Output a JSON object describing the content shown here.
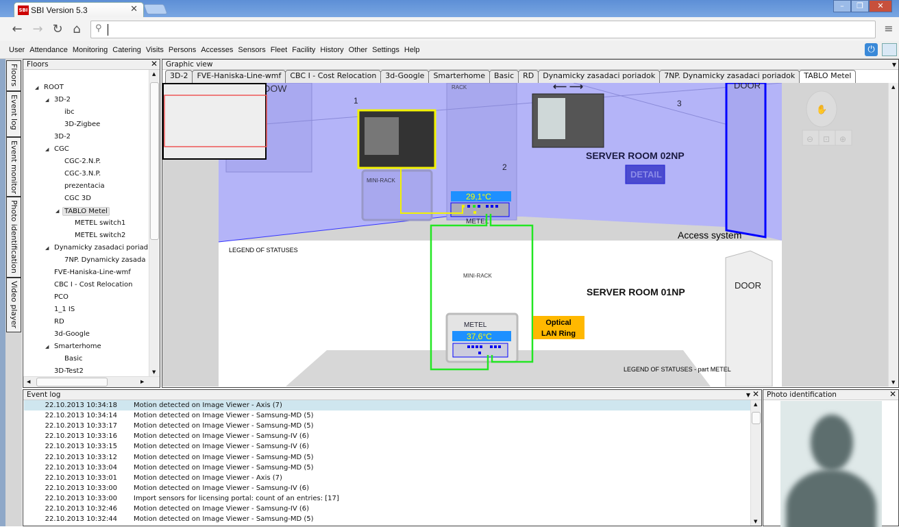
{
  "browser": {
    "tab_title": "SBI Version 5.3",
    "logo": "SBI",
    "address": "",
    "icons": [
      "back-icon",
      "forward-icon",
      "reload-icon",
      "home-icon",
      "search-icon",
      "menu-icon"
    ]
  },
  "menu": [
    "User",
    "Attendance",
    "Monitoring",
    "Catering",
    "Visits",
    "Persons",
    "Accesses",
    "Sensors",
    "Fleet",
    "Facility",
    "History",
    "Other",
    "Settings",
    "Help"
  ],
  "side_tabs": [
    "Floors",
    "Event log",
    "Event monitor",
    "Photo identification",
    "Video player"
  ],
  "floors": {
    "title": "Floors",
    "tree": [
      {
        "label": "ROOT",
        "level": 0,
        "expanded": true
      },
      {
        "label": "3D-2",
        "level": 1,
        "expanded": true
      },
      {
        "label": "ibc",
        "level": 2
      },
      {
        "label": "3D-Zigbee",
        "level": 2
      },
      {
        "label": "3D-2",
        "level": 1
      },
      {
        "label": "CGC",
        "level": 1,
        "expanded": true
      },
      {
        "label": "CGC-2.N.P.",
        "level": 2
      },
      {
        "label": "CGC-3.N.P.",
        "level": 2
      },
      {
        "label": "prezentacia",
        "level": 2
      },
      {
        "label": "CGC 3D",
        "level": 2
      },
      {
        "label": "TABLO Metel",
        "level": 2,
        "expanded": true,
        "selected": true
      },
      {
        "label": "METEL switch1",
        "level": 3
      },
      {
        "label": "METEL switch2",
        "level": 3
      },
      {
        "label": "Dynamicky zasadaci poriad",
        "level": 1,
        "expanded": true
      },
      {
        "label": "7NP. Dynamicky zasada",
        "level": 2
      },
      {
        "label": "FVE-Haniska-Line-wmf",
        "level": 1
      },
      {
        "label": "CBC I - Cost Relocation",
        "level": 1
      },
      {
        "label": "PCO",
        "level": 1
      },
      {
        "label": "1_1 IS",
        "level": 1
      },
      {
        "label": "RD",
        "level": 1
      },
      {
        "label": "3d-Google",
        "level": 1
      },
      {
        "label": "Smarterhome",
        "level": 1,
        "expanded": true
      },
      {
        "label": "Basic",
        "level": 2
      },
      {
        "label": "3D-Test2",
        "level": 1
      }
    ]
  },
  "graphic_view": {
    "title": "Graphic view",
    "tabs": [
      "3D-2",
      "FVE-Haniska-Line-wmf",
      "CBC I - Cost Relocation",
      "3d-Google",
      "Smarterhome",
      "Basic",
      "RD",
      "Dynamicky zasadaci poriadok",
      "7NP. Dynamicky zasadaci poriadok",
      "TABLO Metel"
    ],
    "active_tab": "TABLO Metel",
    "scene": {
      "window": "WINDOW",
      "rack": "RACK",
      "mini_rack_top": "MINI-RACK",
      "mini_rack_bottom": "MINI-RACK",
      "cam1": "1",
      "cam2": "2",
      "cam3": "3",
      "server_room_2": "SERVER ROOM 02NP",
      "detail": "DETAIL",
      "door_top": "DOOR",
      "door_bottom": "DOOR",
      "access": "Access system",
      "legend": "LEGEND OF STATUSES",
      "server_room_1": "SERVER ROOM 01NP",
      "legend_metel": "LEGEND OF STATUSES - part METEL",
      "metel1": "METEL",
      "temp1": "29,1°C",
      "metel2": "METEL",
      "temp2": "37,6°C",
      "optical1": "Optical",
      "optical2": "LAN Ring"
    },
    "colors": {
      "room": "#b4b4f8",
      "temp_bg": "#1e90ff",
      "temp_text": "#ffff00",
      "link_green": "#22e622",
      "link_yellow": "#f2f200",
      "optical": "#ffb800"
    }
  },
  "event_log": {
    "title": "Event log",
    "rows": [
      {
        "ts": "22.10.2013 10:34:18",
        "msg": "Motion detected on Image Viewer - Axis (7)"
      },
      {
        "ts": "22.10.2013 10:34:14",
        "msg": "Motion detected on Image Viewer - Samsung-MD (5)"
      },
      {
        "ts": "22.10.2013 10:33:17",
        "msg": "Motion detected on Image Viewer - Samsung-MD (5)"
      },
      {
        "ts": "22.10.2013 10:33:16",
        "msg": "Motion detected on Image Viewer - Samsung-IV (6)"
      },
      {
        "ts": "22.10.2013 10:33:15",
        "msg": "Motion detected on Image Viewer - Samsung-IV (6)"
      },
      {
        "ts": "22.10.2013 10:33:12",
        "msg": "Motion detected on Image Viewer - Samsung-MD (5)"
      },
      {
        "ts": "22.10.2013 10:33:04",
        "msg": "Motion detected on Image Viewer - Samsung-MD (5)"
      },
      {
        "ts": "22.10.2013 10:33:01",
        "msg": "Motion detected on Image Viewer - Axis (7)"
      },
      {
        "ts": "22.10.2013 10:33:00",
        "msg": "Motion detected on Image Viewer - Samsung-IV (6)"
      },
      {
        "ts": "22.10.2013 10:33:00",
        "msg": "Import sensors for licensing portal: count of an entries: [17]"
      },
      {
        "ts": "22.10.2013 10:32:46",
        "msg": "Motion detected on Image Viewer - Samsung-IV (6)"
      },
      {
        "ts": "22.10.2013 10:32:44",
        "msg": "Motion detected on Image Viewer - Samsung-MD (5)"
      }
    ]
  },
  "photo": {
    "title": "Photo identification"
  }
}
